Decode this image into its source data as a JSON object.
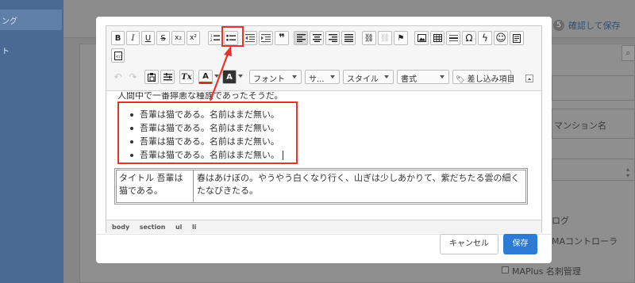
{
  "background": {
    "sidebar": {
      "items": [
        {
          "label": "ング",
          "active": true
        },
        {
          "label": "ト",
          "active": false
        }
      ]
    },
    "header": {
      "count_badge": "5",
      "save_link": "確認して保存"
    },
    "fields": {
      "mansion_name_hint": "マンション名"
    },
    "checkboxes": [
      {
        "label": "ログ"
      },
      {
        "label": "MAコントローラ"
      },
      {
        "label": "MAPlus 名刺管理"
      }
    ]
  },
  "toolbar": {
    "row1": [
      {
        "name": "bold",
        "label": "B"
      },
      {
        "name": "italic",
        "label": "I"
      },
      {
        "name": "underline",
        "label": "U"
      },
      {
        "name": "strike",
        "label": "S"
      },
      {
        "name": "subscript",
        "label": "x₂"
      },
      {
        "name": "superscript",
        "label": "x²"
      },
      {
        "name": "numbered-list",
        "icon": "numbered-list-icon"
      },
      {
        "name": "bulleted-list",
        "icon": "bulleted-list-icon"
      },
      {
        "name": "outdent",
        "icon": "outdent-icon"
      },
      {
        "name": "indent",
        "icon": "indent-icon"
      },
      {
        "name": "blockquote",
        "label": "❞"
      },
      {
        "name": "align-left",
        "icon": "align-left-icon"
      },
      {
        "name": "align-center",
        "icon": "align-center-icon"
      },
      {
        "name": "align-right",
        "icon": "align-right-icon"
      },
      {
        "name": "justify",
        "icon": "justify-icon"
      },
      {
        "name": "link",
        "label": "⛓"
      },
      {
        "name": "unlink",
        "label": "⛓"
      },
      {
        "name": "anchor",
        "label": "⚑"
      },
      {
        "name": "image",
        "icon": "image-icon"
      },
      {
        "name": "table",
        "icon": "table-icon"
      },
      {
        "name": "horizontal-rule",
        "icon": "horizontal-rule-icon"
      },
      {
        "name": "special-char",
        "label": "Ω"
      },
      {
        "name": "iframe",
        "label": "ϟ"
      },
      {
        "name": "smiley",
        "label": "☺"
      },
      {
        "name": "template",
        "icon": "template-icon"
      },
      {
        "name": "source",
        "icon": "source-icon"
      }
    ],
    "row2": {
      "undo": "↶",
      "redo": "↷",
      "paste": "paste-icon",
      "paste_text": "paste-text-icon",
      "remove_format": "Tx",
      "text_color": "A",
      "bg_color": "A",
      "font": "フォント",
      "size": "サ...",
      "styles": "スタイル",
      "format": "書式",
      "merge_field": "差し込み項目"
    }
  },
  "content": {
    "cut_line": "人間中で一番獰悪な種族であったそうだ。",
    "list_items": [
      "吾輩は猫である。名前はまだ無い。",
      "吾輩は猫である。名前はまだ無い。",
      "吾輩は猫である。名前はまだ無い。",
      "吾輩は猫である。名前はまだ無い。"
    ],
    "table": {
      "col1": "タイトル 吾輩は猫である。",
      "col2": "春はあけぼの。やうやう白くなり行く、山ぎは少しあかりて、紫だちたる雲の細くたなびきたる。"
    },
    "path": [
      "body",
      "section",
      "ul",
      "li"
    ]
  },
  "footer": {
    "cancel_label": "キャンセル",
    "save_label": "保存"
  },
  "colors": {
    "accent": "#2e7bd6",
    "highlight": "#e8332a",
    "sidebar": "#4a6a94"
  }
}
